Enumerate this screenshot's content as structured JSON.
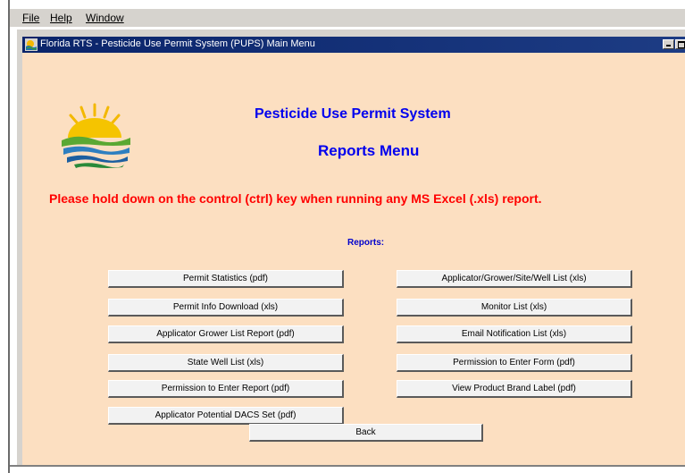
{
  "menubar": {
    "items": [
      {
        "label": "File"
      },
      {
        "label": "Help"
      },
      {
        "label": "Window"
      }
    ]
  },
  "window": {
    "title": "Florida RTS - Pesticide Use Permit System (PUPS) Main Menu"
  },
  "header": {
    "title": "Pesticide Use Permit System",
    "subtitle": "Reports Menu"
  },
  "warning": "Please hold down on the control (ctrl) key when running any MS Excel (.xls) report.",
  "section_label": "Reports:",
  "reports": {
    "left": [
      {
        "label": "Permit Statistics (pdf)"
      },
      {
        "label": "Permit Info Download (xls)"
      },
      {
        "label": "Applicator Grower List Report (pdf)"
      },
      {
        "label": "State Well List (xls)"
      },
      {
        "label": "Permission to Enter Report (pdf)"
      },
      {
        "label": "Applicator Potential DACS Set (pdf)"
      }
    ],
    "right": [
      {
        "label": "Applicator/Grower/Site/Well List (xls)"
      },
      {
        "label": "Monitor List (xls)"
      },
      {
        "label": "Email Notification List (xls)"
      },
      {
        "label": "Permission to Enter Form (pdf)"
      },
      {
        "label": "View Product Brand Label (pdf)"
      }
    ]
  },
  "back_label": "Back",
  "colors": {
    "panel_background": "#fcdfc1",
    "heading": "#0000ee",
    "warning": "#ff0000",
    "titlebar": "#0a246a"
  },
  "icons": {
    "app": "pesticide-app-icon",
    "logo": "sun-waves-logo"
  }
}
